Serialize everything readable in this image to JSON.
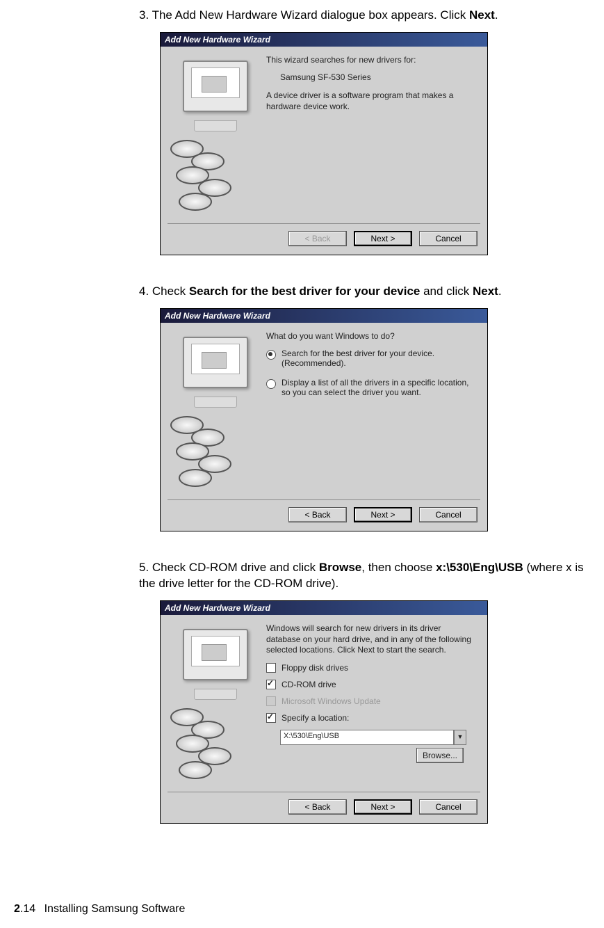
{
  "step3": {
    "prefix": "3. The Add New Hardware Wizard dialogue box appears. Click ",
    "bold": "Next",
    "suffix": "."
  },
  "step4": {
    "prefix": "4. Check ",
    "bold1": "Search for the best driver for your device",
    "mid": " and click ",
    "bold2": "Next",
    "suffix": "."
  },
  "step5": {
    "prefix": "5. Check CD-ROM drive and click ",
    "bold1": "Browse",
    "mid": ", then choose ",
    "bold2": "x:\\530\\Eng\\USB",
    "suffix": " (where x is the drive letter for the CD-ROM drive)."
  },
  "dialog1": {
    "title": "Add New Hardware Wizard",
    "line1": "This wizard searches for new drivers for:",
    "line2": "Samsung SF-530 Series",
    "line3": "A device driver is a software program that makes a hardware device work.",
    "back": "< Back",
    "next": "Next >",
    "cancel": "Cancel"
  },
  "dialog2": {
    "title": "Add New Hardware Wizard",
    "q": "What do you want Windows to do?",
    "opt1": "Search for the best driver for your device. (Recommended).",
    "opt2": "Display a list of all the drivers in a specific location, so you can select the driver you want.",
    "back": "< Back",
    "next": "Next >",
    "cancel": "Cancel"
  },
  "dialog3": {
    "title": "Add New Hardware Wizard",
    "intro": "Windows will search for new drivers in its driver database on your hard drive, and in any of the following selected locations. Click Next to start the search.",
    "chk1": "Floppy disk drives",
    "chk2": "CD-ROM drive",
    "chk3": "Microsoft Windows Update",
    "chk4": "Specify a location:",
    "path": "X:\\530\\Eng\\USB",
    "browse": "Browse...",
    "back": "< Back",
    "next": "Next >",
    "cancel": "Cancel"
  },
  "footer": {
    "chapter": "2",
    "page": ".14",
    "title": "Installing Samsung Software"
  }
}
